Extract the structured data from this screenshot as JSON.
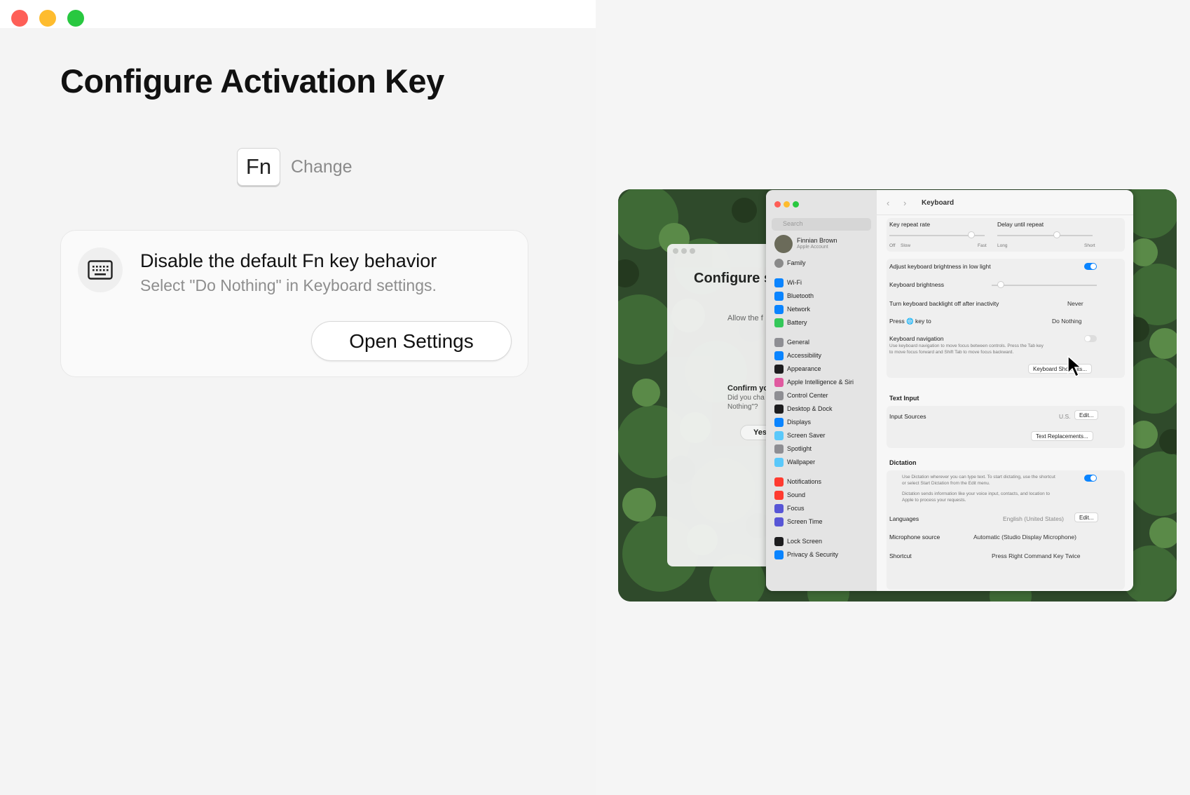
{
  "window": {
    "traffic_lights": {
      "close": "#fe5f57",
      "minimize": "#febc2e",
      "zoom": "#28c840"
    }
  },
  "page": {
    "title": "Configure Activation Key",
    "key_label": "Fn",
    "change_label": "Change"
  },
  "card": {
    "icon": "keyboard-icon",
    "title": "Disable the default Fn key behavior",
    "subtitle": "Select \"Do Nothing\" in Keyboard settings.",
    "button_label": "Open Settings"
  },
  "preview": {
    "mini_window": {
      "title": "Configure s",
      "allow_text": "Allow the f",
      "confirm_title": "Confirm yo",
      "confirm_line1": "Did you cha",
      "confirm_line2": "Nothing\"?",
      "yes_label": "Yes"
    },
    "sidebar": {
      "search_placeholder": "Search",
      "user_name": "Finnian Brown",
      "user_sub": "Apple Account",
      "family": "Family",
      "items": [
        "Wi-Fi",
        "Bluetooth",
        "Network",
        "Battery",
        "General",
        "Accessibility",
        "Appearance",
        "Apple Intelligence & Siri",
        "Control Center",
        "Desktop & Dock",
        "Displays",
        "Screen Saver",
        "Spotlight",
        "Wallpaper",
        "Notifications",
        "Sound",
        "Focus",
        "Screen Time",
        "Lock Screen",
        "Privacy & Security"
      ]
    },
    "keyboard": {
      "title": "Keyboard",
      "key_repeat_rate": "Key repeat rate",
      "delay_until_repeat": "Delay until repeat",
      "off": "Off",
      "slow": "Slow",
      "fast": "Fast",
      "long": "Long",
      "short": "Short",
      "adjust_brightness": "Adjust keyboard brightness in low light",
      "keyboard_brightness": "Keyboard brightness",
      "backlight_off": "Turn keyboard backlight off after inactivity",
      "backlight_value": "Never",
      "press_key": "Press 🌐 key to",
      "press_key_value": "Do Nothing",
      "keyboard_navigation": "Keyboard navigation",
      "nav_desc1": "Use keyboard navigation to move focus between controls. Press the Tab key",
      "nav_desc2": "to move focus forward and Shift Tab to move focus backward.",
      "shortcuts_button": "Keyboard Shortcuts...",
      "text_input_heading": "Text Input",
      "input_sources": "Input Sources",
      "input_sources_value": "U.S.",
      "edit": "Edit...",
      "text_replacements": "Text Replacements...",
      "dictation_heading": "Dictation",
      "dictation_desc1": "Use Dictation wherever you can type text. To start dictating, use the shortcut",
      "dictation_desc2": "or select Start Dictation from the Edit menu.",
      "dictation_desc3": "Dictation sends information like your voice input, contacts, and location to",
      "dictation_desc4": "Apple to process your requests.",
      "languages": "Languages",
      "languages_value": "English (United States)",
      "mic_source": "Microphone source",
      "mic_value": "Automatic (Studio Display Microphone)",
      "shortcut": "Shortcut",
      "shortcut_value": "Press Right Command Key Twice"
    }
  }
}
